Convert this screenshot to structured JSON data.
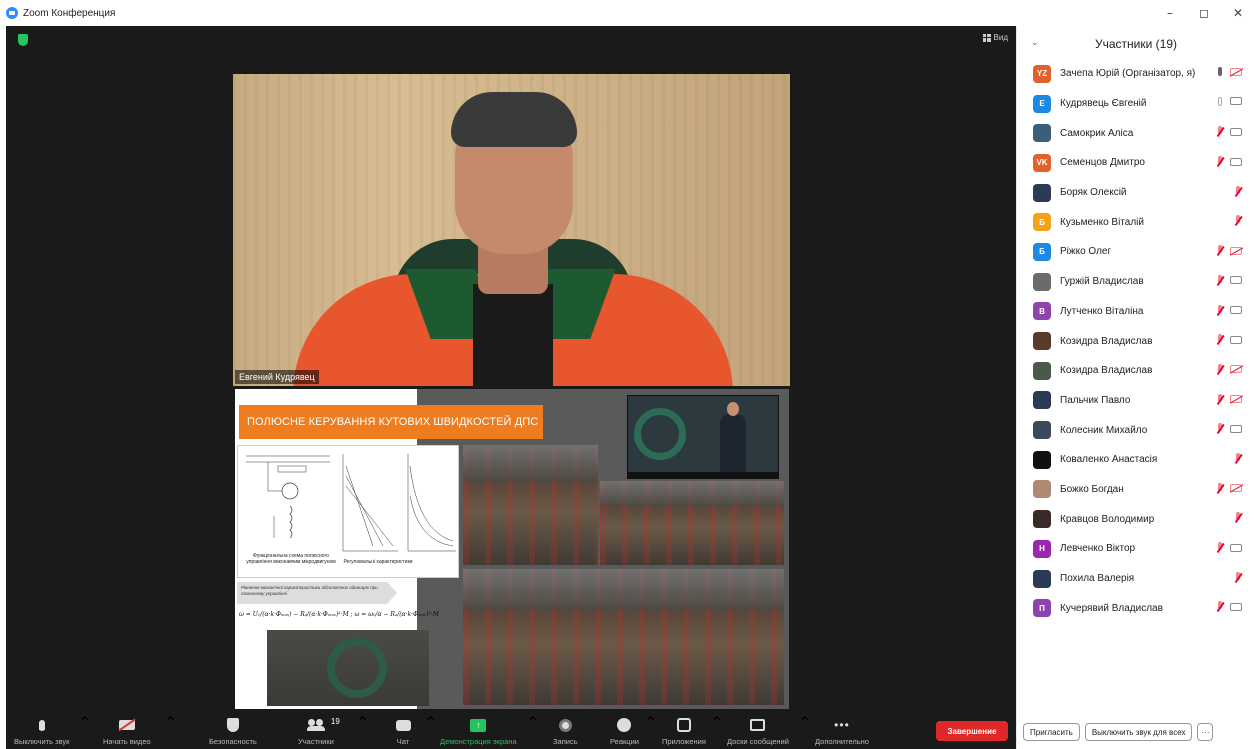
{
  "window": {
    "title": "Zoom Конференция",
    "minimize": "–",
    "maximize": "◻",
    "close": "✕"
  },
  "meeting": {
    "view_label": "Вид",
    "camera_name": "Евгений Кудрявец",
    "slide": {
      "header": "ПОЛЮСНЕ КЕРУВАННЯ КУТОВИХ ШВИДКОСТЕЙ ДПС",
      "diagram_caption_left": "Функціональна схема полюсного управління виконавчим мікродвигуном",
      "diagram_caption_right": "Регулювальні характеристики",
      "note": "Рівняння механічної характеристики абсолютних одиницях при полюсному управлінні",
      "formula": "ω = U₁/(α·k·Φₘₐₓ) − Rₐ/(α·k·Φₘₐₓ)²·M ;  ω = ω₀/α − Rₐ/(α·k·Φₘₐₓ)²·M"
    }
  },
  "toolbar": {
    "mute": "Выключить звук",
    "video": "Начать видео",
    "security": "Безопасность",
    "participants": "Участники",
    "participants_count": "19",
    "chat": "Чат",
    "share": "Демонстрация экрана",
    "record": "Запись",
    "reactions": "Реакции",
    "apps": "Приложения",
    "whiteboards": "Доски сообщений",
    "more": "Дополнительно",
    "end": "Завершение"
  },
  "panel": {
    "title": "Участники (19)",
    "participants": [
      {
        "name": "Зачепа Юрій (Організатор, я)",
        "initials": "YZ",
        "color": "#e3622b",
        "mic": "on",
        "video": "off"
      },
      {
        "name": "Кудрявець Євгеній",
        "initials": "Е",
        "color": "#1e88e5",
        "mic": "idle",
        "video": "on"
      },
      {
        "name": "Самокрик Аліса",
        "initials": "",
        "color": "#3b5f7a",
        "mic": "off",
        "video": "on"
      },
      {
        "name": "Семенцов Дмитро",
        "initials": "VK",
        "color": "#e3622b",
        "mic": "off",
        "video": "on"
      },
      {
        "name": "Боряк Олексій",
        "initials": "",
        "color": "#2b3a55",
        "mic": "off",
        "video": "none"
      },
      {
        "name": "Кузьменко Віталій",
        "initials": "Б",
        "color": "#f2a31a",
        "mic": "off",
        "video": "none"
      },
      {
        "name": "Ріжко Олег",
        "initials": "Б",
        "color": "#1e88e5",
        "mic": "off",
        "video": "off"
      },
      {
        "name": "Гуржій Владислав",
        "initials": "",
        "color": "#6b6b6b",
        "mic": "off",
        "video": "on"
      },
      {
        "name": "Лутченко Віталіна",
        "initials": "В",
        "color": "#8e44ad",
        "mic": "off",
        "video": "on"
      },
      {
        "name": "Козидра Владислав",
        "initials": "",
        "color": "#5a3a2a",
        "mic": "off",
        "video": "on"
      },
      {
        "name": "Козидра Владислав",
        "initials": "",
        "color": "#4a5a4a",
        "mic": "off",
        "video": "off"
      },
      {
        "name": "Пальчик Павло",
        "initials": "",
        "color": "#2b3a55",
        "mic": "off",
        "video": "off"
      },
      {
        "name": "Колесник Михайло",
        "initials": "",
        "color": "#3a4a5a",
        "mic": "off",
        "video": "on"
      },
      {
        "name": "Коваленко Анастасія",
        "initials": "",
        "color": "#111111",
        "mic": "off",
        "video": "none"
      },
      {
        "name": "Божко Богдан",
        "initials": "",
        "color": "#b08a70",
        "mic": "off",
        "video": "off"
      },
      {
        "name": "Кравцов Володимир",
        "initials": "",
        "color": "#3a2a2a",
        "mic": "off",
        "video": "none"
      },
      {
        "name": "Левченко Віктор",
        "initials": "Н",
        "color": "#9b27b0",
        "mic": "off",
        "video": "on"
      },
      {
        "name": "Похила Валерія",
        "initials": "",
        "color": "#2b3a55",
        "mic": "off",
        "video": "none"
      },
      {
        "name": "Кучерявий Владислав",
        "initials": "П",
        "color": "#8e44ad",
        "mic": "off",
        "video": "on"
      }
    ],
    "invite": "Пригласить",
    "mute_all": "Выключить звук для всех",
    "more": "···"
  }
}
